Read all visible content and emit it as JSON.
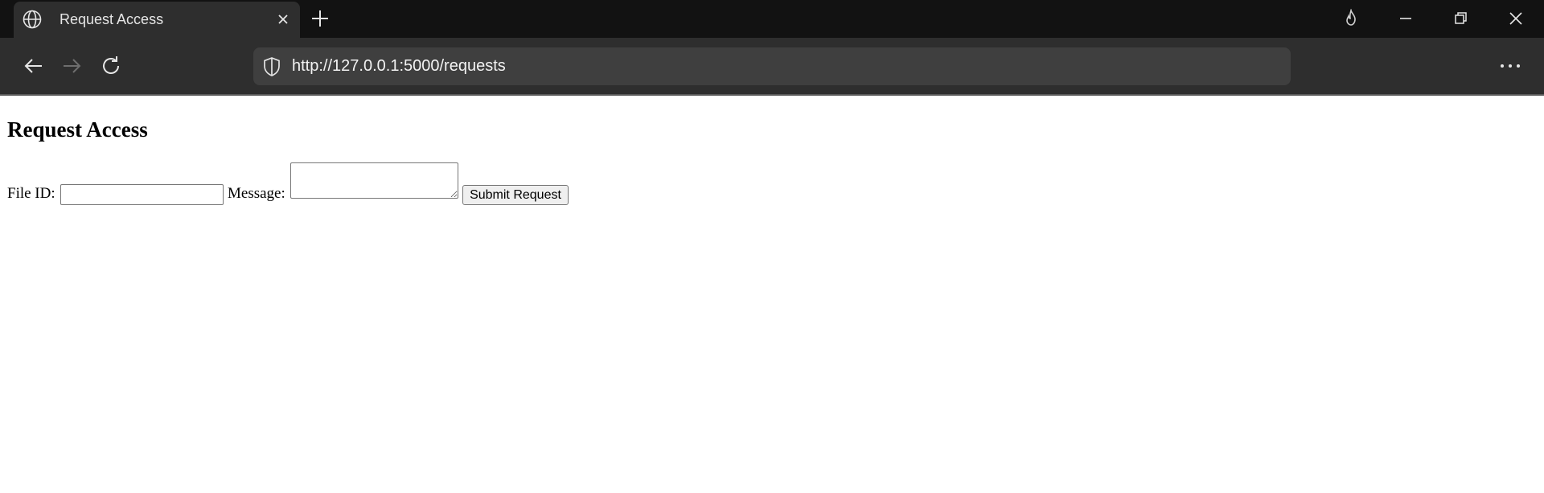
{
  "browser": {
    "tab": {
      "title": "Request Access",
      "icon": "globe-icon"
    },
    "url": "http://127.0.0.1:5000/requests",
    "icons": {
      "new_tab": "plus-icon",
      "back": "back-arrow-icon",
      "forward": "forward-arrow-icon",
      "reload": "reload-icon",
      "security": "shield-icon",
      "firefox_view": "flame-icon",
      "minimize": "minimize-icon",
      "restore": "restore-icon",
      "close": "close-icon",
      "menu": "more-dots-icon"
    },
    "colors": {
      "titlebar": "#121212",
      "tab": "#2e2e2e",
      "toolbar": "#2e2e2e",
      "urlbar": "#3f3f3f"
    }
  },
  "page": {
    "heading": "Request Access",
    "form": {
      "file_id_label": "File ID:",
      "file_id_value": "",
      "message_label": "Message:",
      "message_value": "",
      "submit_label": "Submit Request"
    }
  }
}
